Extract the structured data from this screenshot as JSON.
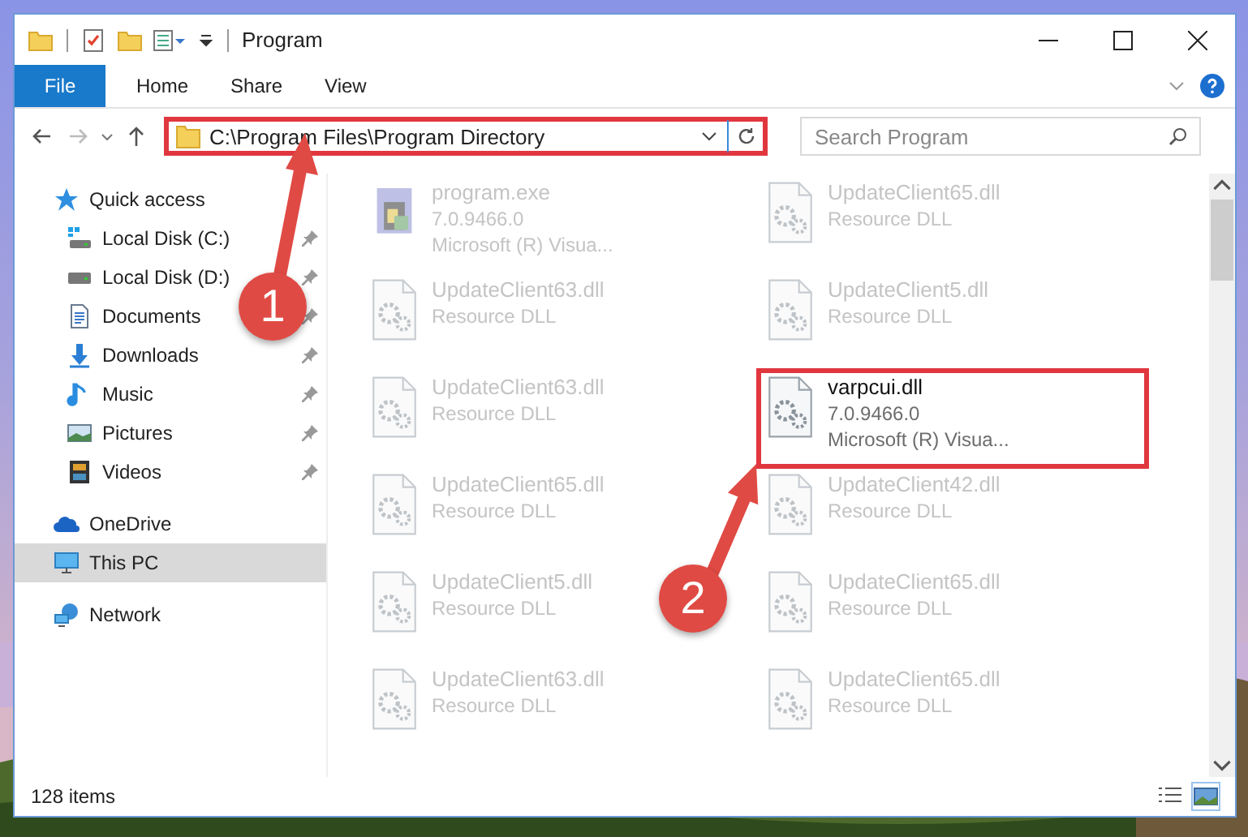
{
  "window": {
    "title": "Program"
  },
  "ribbon_tabs": [
    {
      "label": "File",
      "kind": "file"
    },
    {
      "label": "Home",
      "kind": "tab"
    },
    {
      "label": "Share",
      "kind": "tab"
    },
    {
      "label": "View",
      "kind": "tab"
    }
  ],
  "address": {
    "path": "C:\\Program Files\\Program Directory",
    "highlighted": true
  },
  "search": {
    "placeholder": "Search Program"
  },
  "sidebar": [
    {
      "label": "Quick access",
      "kind": "star",
      "selected": false,
      "children": [
        {
          "label": "Local Disk (C:)",
          "kind": "drive_win",
          "pinned": true,
          "selected": false
        },
        {
          "label": "Local Disk (D:)",
          "kind": "drive",
          "pinned": true,
          "selected": false
        },
        {
          "label": "Documents",
          "kind": "document",
          "pinned": true,
          "selected": false
        },
        {
          "label": "Downloads",
          "kind": "download",
          "pinned": true,
          "selected": false
        },
        {
          "label": "Music",
          "kind": "music",
          "pinned": true,
          "selected": false
        },
        {
          "label": "Pictures",
          "kind": "pictures",
          "pinned": true,
          "selected": false
        },
        {
          "label": "Videos",
          "kind": "videos",
          "pinned": true,
          "selected": false
        }
      ]
    },
    {
      "label": "OneDrive",
      "kind": "cloud",
      "selected": false
    },
    {
      "label": "This PC",
      "kind": "pc",
      "selected": true
    },
    {
      "label": "Network",
      "kind": "network",
      "selected": false
    }
  ],
  "files": [
    {
      "name": "program.exe",
      "details": [
        "7.0.9466.0",
        "Microsoft (R) Visua..."
      ],
      "kind": "exe",
      "blurred": true,
      "highlighted": false
    },
    {
      "name": "UpdateClient65.dll",
      "details": [
        "Resource DLL"
      ],
      "kind": "dll",
      "blurred": true,
      "highlighted": false
    },
    {
      "name": "UpdateClient63.dll",
      "details": [
        "Resource DLL"
      ],
      "kind": "dll",
      "blurred": true,
      "highlighted": false
    },
    {
      "name": "UpdateClient5.dll",
      "details": [
        "Resource DLL"
      ],
      "kind": "dll",
      "blurred": true,
      "highlighted": false
    },
    {
      "name": "UpdateClient63.dll",
      "details": [
        "Resource DLL"
      ],
      "kind": "dll",
      "blurred": true,
      "highlighted": false
    },
    {
      "name": "varpcui.dll",
      "details": [
        "7.0.9466.0",
        "Microsoft (R) Visua..."
      ],
      "kind": "dll",
      "blurred": false,
      "highlighted": true
    },
    {
      "name": "UpdateClient65.dll",
      "details": [
        "Resource DLL"
      ],
      "kind": "dll",
      "blurred": true,
      "highlighted": false
    },
    {
      "name": "UpdateClient42.dll",
      "details": [
        "Resource DLL"
      ],
      "kind": "dll",
      "blurred": true,
      "highlighted": false
    },
    {
      "name": "UpdateClient5.dll",
      "details": [
        "Resource DLL"
      ],
      "kind": "dll",
      "blurred": true,
      "highlighted": false
    },
    {
      "name": "UpdateClient65.dll",
      "details": [
        "Resource DLL"
      ],
      "kind": "dll",
      "blurred": true,
      "highlighted": false
    },
    {
      "name": "UpdateClient63.dll",
      "details": [
        "Resource DLL"
      ],
      "kind": "dll",
      "blurred": true,
      "highlighted": false
    },
    {
      "name": "UpdateClient65.dll",
      "details": [
        "Resource DLL"
      ],
      "kind": "dll",
      "blurred": true,
      "highlighted": false
    }
  ],
  "callouts": [
    {
      "number": "1"
    },
    {
      "number": "2"
    }
  ],
  "status_bar": {
    "count": "128 items"
  }
}
